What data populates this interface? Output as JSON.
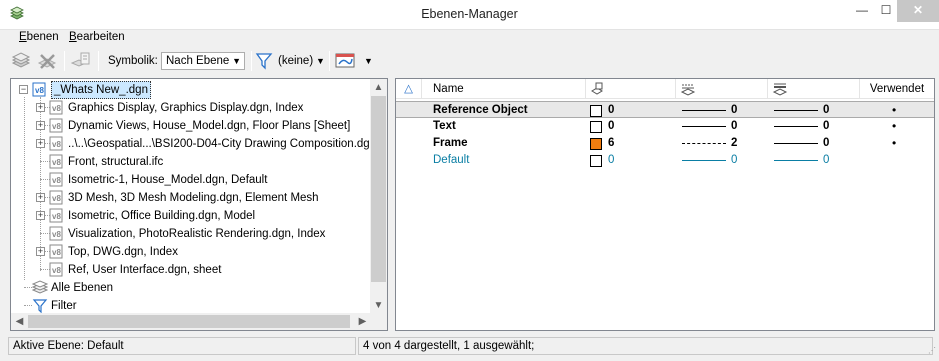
{
  "window": {
    "title": "Ebenen-Manager",
    "min_glyph": "—",
    "max_glyph": "☐",
    "close_glyph": "✕"
  },
  "menu": [
    {
      "label": "Ebenen"
    },
    {
      "label": "Bearbeiten"
    }
  ],
  "toolbar": {
    "symbolik_label": "Symbolik:",
    "symbolik_value": "Nach Ebene",
    "filter_value": "(keine)"
  },
  "tree": {
    "root": "_Whats New_.dgn",
    "children": [
      {
        "label": "Graphics Display, Graphics Display.dgn, Index",
        "expandable": true
      },
      {
        "label": "Dynamic Views, House_Model.dgn, Floor Plans [Sheet]",
        "expandable": true
      },
      {
        "label": "..\\..\\Geospatial...\\BSI200-D04-City Drawing Composition.dgn",
        "expandable": true
      },
      {
        "label": "Front, structural.ifc",
        "expandable": false
      },
      {
        "label": "Isometric-1, House_Model.dgn, Default",
        "expandable": false
      },
      {
        "label": "3D Mesh, 3D Mesh Modeling.dgn, Element Mesh",
        "expandable": true
      },
      {
        "label": "Isometric, Office Building.dgn, Model",
        "expandable": true
      },
      {
        "label": "Visualization, PhotoRealistic Rendering.dgn, Index",
        "expandable": false
      },
      {
        "label": "Top, DWG.dgn, Index",
        "expandable": true
      },
      {
        "label": "Ref, User Interface.dgn, sheet",
        "expandable": false
      }
    ],
    "all_layers": "Alle Ebenen",
    "filter": "Filter"
  },
  "grid": {
    "headers": {
      "name": "Name",
      "used": "Verwendet"
    },
    "rows": [
      {
        "name": "Reference Object",
        "color": "0",
        "swatch": "#ffffff",
        "style": "0",
        "weight": "0",
        "used": "•",
        "style_type": "solid",
        "selected": true,
        "bold": true,
        "blue": false
      },
      {
        "name": "Text",
        "color": "0",
        "swatch": "#ffffff",
        "style": "0",
        "weight": "0",
        "used": "•",
        "style_type": "solid",
        "selected": false,
        "bold": true,
        "blue": false
      },
      {
        "name": "Frame",
        "color": "6",
        "swatch": "#f07d10",
        "style": "2",
        "weight": "0",
        "used": "•",
        "style_type": "dash",
        "selected": false,
        "bold": true,
        "blue": false
      },
      {
        "name": "Default",
        "color": "0",
        "swatch": "#ffffff",
        "style": "0",
        "weight": "0",
        "used": "",
        "style_type": "solid",
        "selected": false,
        "bold": false,
        "blue": true
      }
    ]
  },
  "status": {
    "active_layer": "Aktive Ebene: Default",
    "summary": "4 von 4 dargestellt, 1 ausgewählt;"
  }
}
